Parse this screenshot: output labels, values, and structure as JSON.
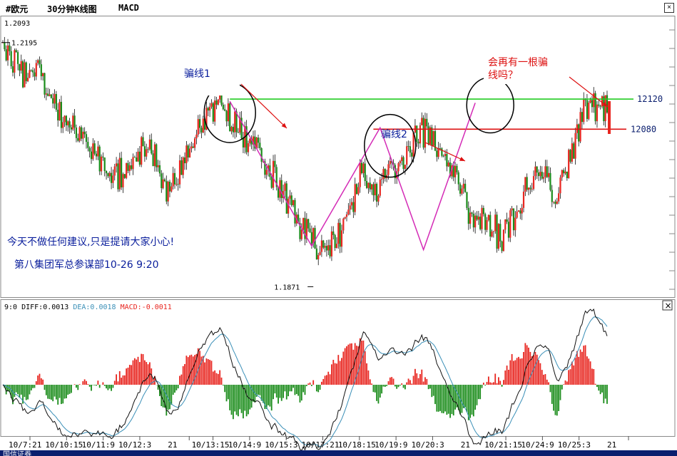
{
  "header": {
    "symbol": "#欧元",
    "period": "30分钟K线图",
    "indicator": "MACD"
  },
  "statusbar": {
    "text": "国信证券"
  },
  "colors": {
    "up": "#e8251f",
    "down": "#1a8c1a",
    "wick": "#101010",
    "trend": "#d42bb6",
    "resist": "#22cc22",
    "support": "#dd1111",
    "diff_line": "#111111",
    "dea_line": "#3a8fb7",
    "circle": "#000000",
    "arrow": "#dd1111",
    "annot_blue": "#0a1e9c",
    "annot_red": "#dd1111"
  },
  "chart_data": [
    {
      "type": "candlestick",
      "title": "30分钟K线图",
      "ylim": [
        1.186,
        1.2225
      ],
      "y_top_label": "1.2093",
      "price_high_label": "1.2195",
      "price_low_label": "1.1871",
      "levels": [
        {
          "value": 1.212,
          "label": "12120",
          "color": "resist"
        },
        {
          "value": 1.208,
          "label": "12080",
          "color": "support"
        }
      ],
      "x_labels": [
        "10/7:21",
        "10/10:15",
        "10/11:9",
        "10/12:3",
        "21",
        "10/13:15",
        "10/14:9",
        "10/15:3",
        "10/17:21",
        "10/18:15",
        "10/19:9",
        "10/20:3",
        "21",
        "10/21:15",
        "10/24:9",
        "10/25:3",
        "21"
      ],
      "anchors": [
        [
          0,
          1.2195
        ],
        [
          6,
          1.2175
        ],
        [
          14,
          1.215
        ],
        [
          22,
          1.2155
        ],
        [
          30,
          1.211
        ],
        [
          40,
          1.2085
        ],
        [
          52,
          1.2055
        ],
        [
          66,
          1.2015
        ],
        [
          76,
          1.204
        ],
        [
          88,
          1.206
        ],
        [
          98,
          1.2
        ],
        [
          106,
          1.203
        ],
        [
          114,
          1.2065
        ],
        [
          124,
          1.21
        ],
        [
          130,
          1.2115
        ],
        [
          140,
          1.2085
        ],
        [
          152,
          1.206
        ],
        [
          164,
          1.201
        ],
        [
          176,
          1.1965
        ],
        [
          186,
          1.1935
        ],
        [
          194,
          1.1915
        ],
        [
          200,
          1.193
        ],
        [
          206,
          1.196
        ],
        [
          214,
          1.202
        ],
        [
          222,
          1.2
        ],
        [
          232,
          1.203
        ],
        [
          242,
          1.205
        ],
        [
          254,
          1.2085
        ],
        [
          262,
          1.206
        ],
        [
          270,
          1.2025
        ],
        [
          280,
          1.1965
        ],
        [
          290,
          1.1955
        ],
        [
          298,
          1.1935
        ],
        [
          306,
          1.196
        ],
        [
          314,
          1.2
        ],
        [
          322,
          1.203
        ],
        [
          330,
          1.199
        ],
        [
          338,
          1.203
        ],
        [
          346,
          1.209
        ],
        [
          352,
          1.2115
        ],
        [
          358,
          1.211
        ],
        [
          362,
          1.2105
        ]
      ],
      "candle_count": 363,
      "annotations": [
        {
          "text": "骗线1",
          "color": "annot_blue"
        },
        {
          "text": "骗线2",
          "color": "annot_blue"
        },
        {
          "lines": [
            "会再有一根骗",
            "线吗？"
          ],
          "color": "annot_red"
        },
        {
          "text": "今天不做任何建议,只是提请大家小心!",
          "color": "annot_blue"
        },
        {
          "text": "第八集团军总参谋部10-26 9:20",
          "color": "annot_blue"
        }
      ]
    },
    {
      "type": "macd",
      "params": "9:0",
      "diff_label": "DIFF:0.0013",
      "dea_label": "DEA:0.0018",
      "macd_label": "MACD:-0.0011",
      "diff": {
        "value": 0.0013
      },
      "dea": {
        "value": 0.0018
      },
      "macd": {
        "value": -0.0011
      }
    }
  ]
}
